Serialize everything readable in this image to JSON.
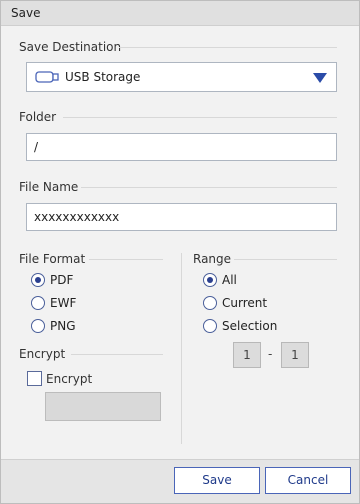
{
  "window": {
    "title": "Save"
  },
  "save_destination": {
    "label": "Save Destination",
    "selected": "USB Storage",
    "icon": "usb-drive-icon"
  },
  "folder": {
    "label": "Folder",
    "value": "/"
  },
  "file_name": {
    "label": "File Name",
    "value": "xxxxxxxxxxxx"
  },
  "file_format": {
    "label": "File Format",
    "options": [
      {
        "label": "PDF",
        "checked": true
      },
      {
        "label": "EWF",
        "checked": false
      },
      {
        "label": "PNG",
        "checked": false
      }
    ]
  },
  "encrypt": {
    "label": "Encrypt",
    "checkbox_label": "Encrypt",
    "checked": false,
    "password": ""
  },
  "range": {
    "label": "Range",
    "options": [
      {
        "label": "All",
        "checked": true
      },
      {
        "label": "Current",
        "checked": false
      },
      {
        "label": "Selection",
        "checked": false
      }
    ],
    "from": "1",
    "separator": "-",
    "to": "1"
  },
  "buttons": {
    "save": "Save",
    "cancel": "Cancel"
  },
  "colors": {
    "accent": "#2a4ba8",
    "field_border": "#aeb6c1",
    "background": "#f2f2f2"
  }
}
